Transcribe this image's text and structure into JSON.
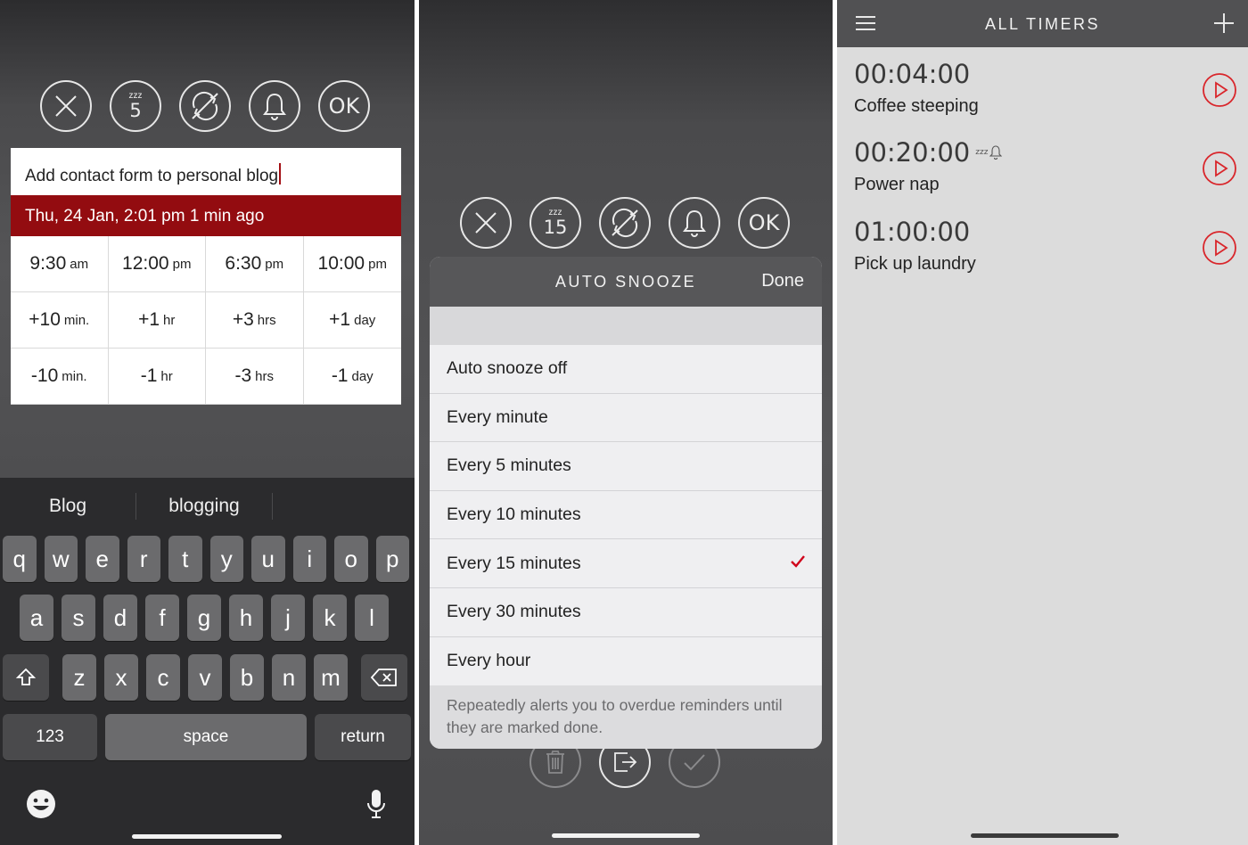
{
  "panel_left": {
    "actions": [
      "dismiss",
      "snooze",
      "repeat",
      "alert",
      "ok"
    ],
    "snooze_number": "5",
    "snooze_z": "zzz",
    "ok_label": "OK",
    "reminder_title": "Add contact form to personal blog",
    "date_line": "Thu, 24 Jan, 2:01 pm 1 min ago",
    "quick_times": [
      {
        "num": "9:30",
        "unit": "am"
      },
      {
        "num": "12:00",
        "unit": "pm"
      },
      {
        "num": "6:30",
        "unit": "pm"
      },
      {
        "num": "10:00",
        "unit": "pm"
      },
      {
        "num": "+10",
        "unit": "min."
      },
      {
        "num": "+1",
        "unit": "hr"
      },
      {
        "num": "+3",
        "unit": "hrs"
      },
      {
        "num": "+1",
        "unit": "day"
      },
      {
        "num": "-10",
        "unit": "min."
      },
      {
        "num": "-1",
        "unit": "hr"
      },
      {
        "num": "-3",
        "unit": "hrs"
      },
      {
        "num": "-1",
        "unit": "day"
      }
    ],
    "keyboard": {
      "suggestions": [
        "Blog",
        "blogging",
        ""
      ],
      "row1": [
        "q",
        "w",
        "e",
        "r",
        "t",
        "y",
        "u",
        "i",
        "o",
        "p"
      ],
      "row2": [
        "a",
        "s",
        "d",
        "f",
        "g",
        "h",
        "j",
        "k",
        "l"
      ],
      "row3": [
        "z",
        "x",
        "c",
        "v",
        "b",
        "n",
        "m"
      ],
      "numbers_label": "123",
      "space_label": "space",
      "return_label": "return"
    }
  },
  "panel_middle": {
    "snooze_number": "15",
    "snooze_z": "zzz",
    "ok_label": "OK",
    "sheet_title": "AUTO SNOOZE",
    "done_label": "Done",
    "options": [
      "Auto snooze off",
      "Every minute",
      "Every 5 minutes",
      "Every 10 minutes",
      "Every 15 minutes",
      "Every 30 minutes",
      "Every hour"
    ],
    "selected_option": "Every 15 minutes",
    "footnote": "Repeatedly alerts you to overdue reminders until they are marked done.",
    "accent": "#d0021b"
  },
  "panel_right": {
    "title": "ALL TIMERS",
    "timers": [
      {
        "time": "00:04:00",
        "label": "Coffee steeping",
        "snooze": false
      },
      {
        "time": "00:20:00",
        "label": "Power nap",
        "snooze": true
      },
      {
        "time": "01:00:00",
        "label": "Pick up laundry",
        "snooze": false
      }
    ],
    "accent": "#d9262b"
  }
}
